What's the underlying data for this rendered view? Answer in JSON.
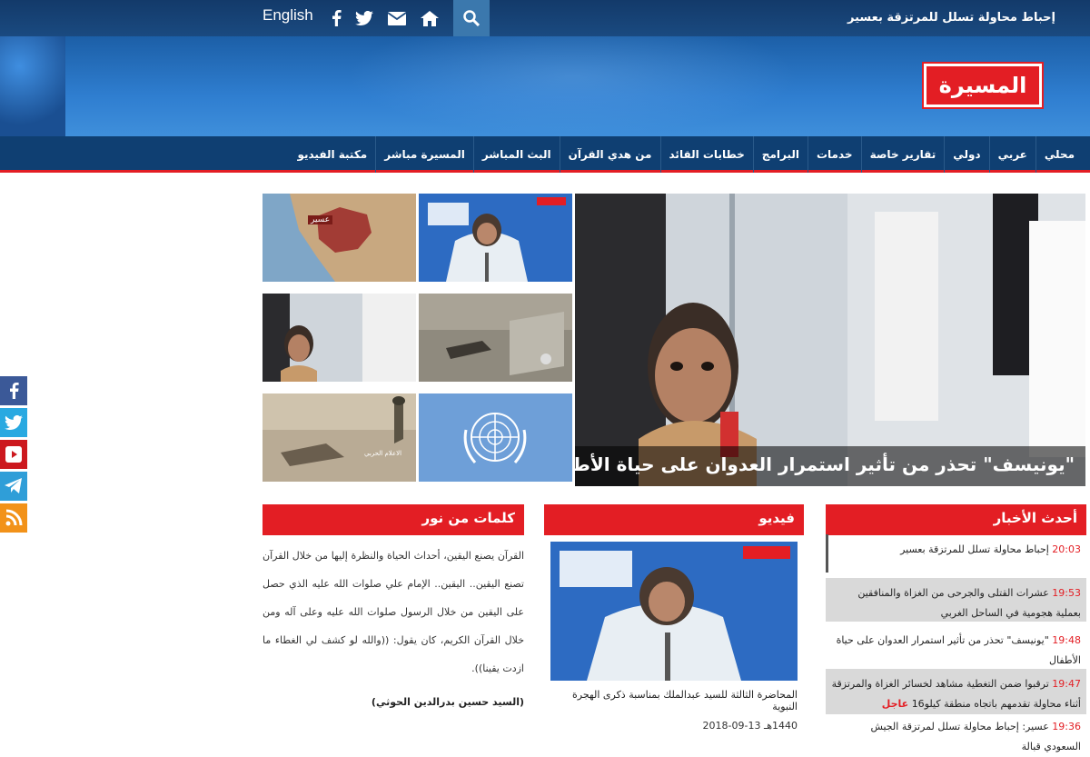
{
  "topbar": {
    "ticker": "إحباط محاولة تسلل للمرتزقة بعسير",
    "lang": "English",
    "icons": [
      "facebook-icon",
      "twitter-icon",
      "mail-icon",
      "home-icon",
      "search-icon"
    ]
  },
  "logo": {
    "text": "المسيرة"
  },
  "nav": {
    "items": [
      "محلي",
      "عربي",
      "دولي",
      "تقارير خاصة",
      "خدمات",
      "البرامج",
      "خطابات القائد",
      "من هدي القرآن",
      "البث المباشر",
      "المسيرة مباشر",
      "مكتبة الفيديو"
    ]
  },
  "hero": {
    "caption": "\"يونيسف\" تحذر من تأثير استمرار العدوان على حياة الأطفال"
  },
  "thumbs": {
    "map_label": "عسير",
    "army_label": "الاعلام الحربي"
  },
  "sections": {
    "words": {
      "title": "كلمات من نور",
      "text": "القرآن يصنع اليقين، أحداث الحياة والنظرة إليها من خلال القرآن تصنع اليقين.. اليقين.. الإمام علي صلوات الله عليه الذي حصل على اليقين من خلال الرسول صلوات الله عليه وعلى آله ومن خلال القرآن الكريم، كان يقول: ((والله لو كشف لي الغطاء ما ازدت يقينا)).",
      "author": "(السيد حسين بدرالدين الحوثي)"
    },
    "video": {
      "title": "فيديو",
      "caption": "المحاضرة الثالثة للسيد عبدالملك بمناسبة ذكرى الهجرة النبوية",
      "date": "1440هـ 13-09-2018"
    },
    "latest": {
      "title": "أحدث الأخبار",
      "items": [
        {
          "time": "20:03",
          "text": "إحباط محاولة تسلل للمرتزقة بعسير",
          "urgent": ""
        },
        {
          "time": "19:53",
          "text": "عشرات القتلى والجرحى من الغزاة والمنافقين بعملية هجومية في الساحل الغربي",
          "urgent": ""
        },
        {
          "time": "19:48",
          "text": "\"يونيسف\" تحذر من تأثير استمرار العدوان على حياة الأطفال",
          "urgent": ""
        },
        {
          "time": "19:47",
          "text": "ترقبوا ضمن التغطية مشاهد لخسائر الغزاة والمرتزقة أثناء محاولة تقدمهم باتجاه منطقة كيلو16",
          "urgent": "عاجل"
        },
        {
          "time": "19:36",
          "text": "عسير: إحباط محاولة تسلل لمرتزقة الجيش السعودي قبالة",
          "urgent": ""
        }
      ]
    }
  },
  "colors": {
    "accent": "#e31e24",
    "nav": "#0f3f72",
    "header": "#2f7ed0"
  }
}
